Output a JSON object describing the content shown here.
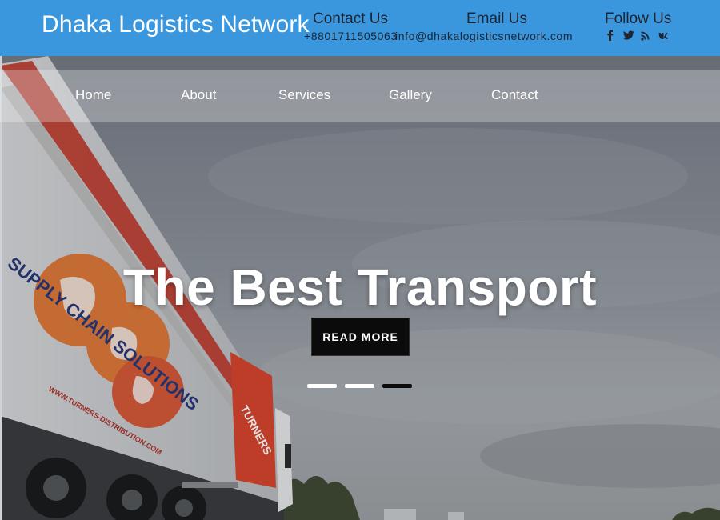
{
  "header": {
    "brand": "Dhaka Logistics Network",
    "contact": {
      "heading": "Contact Us",
      "value": "+8801711505063"
    },
    "email": {
      "heading": "Email Us",
      "value": "info@dhakalogisticsnetwork.com"
    },
    "follow": {
      "heading": "Follow Us",
      "icons": [
        "facebook-icon",
        "twitter-icon",
        "rss-icon",
        "vk-icon"
      ]
    },
    "bg_color": "#3a97dd"
  },
  "nav": {
    "items": [
      {
        "label": "Home"
      },
      {
        "label": "About"
      },
      {
        "label": "Services"
      },
      {
        "label": "Gallery"
      },
      {
        "label": "Contact"
      }
    ]
  },
  "hero": {
    "title": "The Best Transport",
    "button_label": "READ MORE",
    "slides": 3,
    "active_slide": 3,
    "truck_text": {
      "line1": "SUPPLY CHAIN SOLUTIONS",
      "url": "WWW.TURNERS-DISTRIBUTION.COM",
      "brand": "TURNERS"
    }
  }
}
